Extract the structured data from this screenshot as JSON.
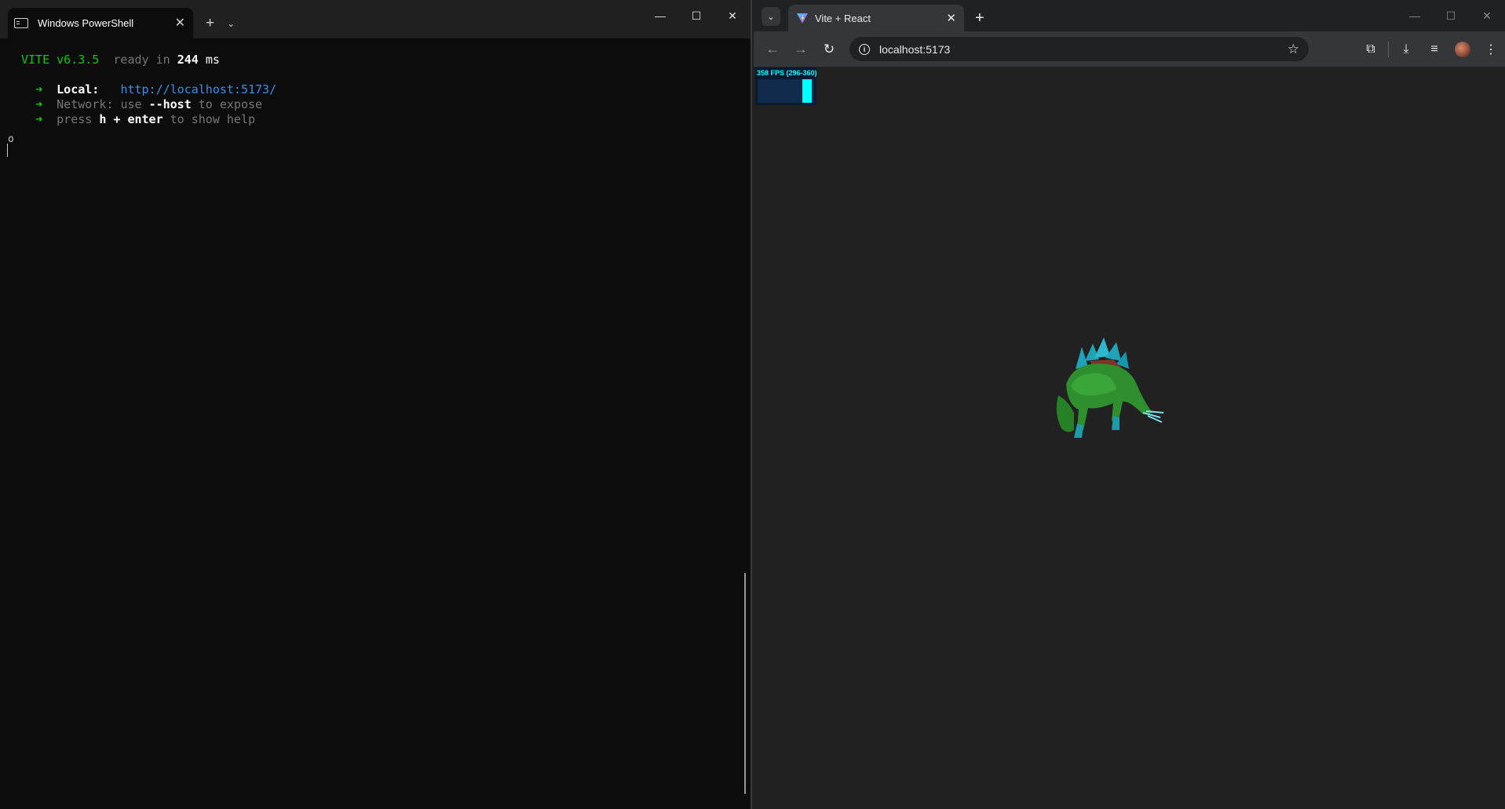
{
  "terminal": {
    "tab_title": "Windows PowerShell",
    "tab_close": "✕",
    "new_tab": "+",
    "dropdown": "⌄",
    "controls": {
      "minimize": "—",
      "maximize": "☐",
      "close": "✕"
    },
    "lines": {
      "vite_name": "VITE v6.3.5",
      "ready_text": "ready in",
      "ready_ms": "244",
      "ms_unit": "ms",
      "local_label": "Local:",
      "local_url": "http://localhost:5173/",
      "network_label": "Network:",
      "network_use": "use",
      "network_flag": "--host",
      "network_expose": "to expose",
      "help_press": "press",
      "help_keys": "h + enter",
      "help_tail": "to show help",
      "arrow": "➜"
    },
    "prompt_char": "o"
  },
  "browser": {
    "tab_search": "⌄",
    "tab_title": "Vite + React",
    "tab_close": "✕",
    "new_tab": "+",
    "controls": {
      "minimize": "—",
      "maximize": "☐",
      "close": "✕"
    },
    "nav": {
      "back": "←",
      "forward": "→",
      "reload": "↻"
    },
    "address": "localhost:5173",
    "info_icon": "i",
    "bookmark": "☆",
    "toolbar_icons": {
      "extensions": "⧉",
      "downloads": "⤓",
      "media": "≡"
    },
    "stats": {
      "fps_text": "358 FPS (296-360)",
      "fps_level": 0.99
    }
  }
}
